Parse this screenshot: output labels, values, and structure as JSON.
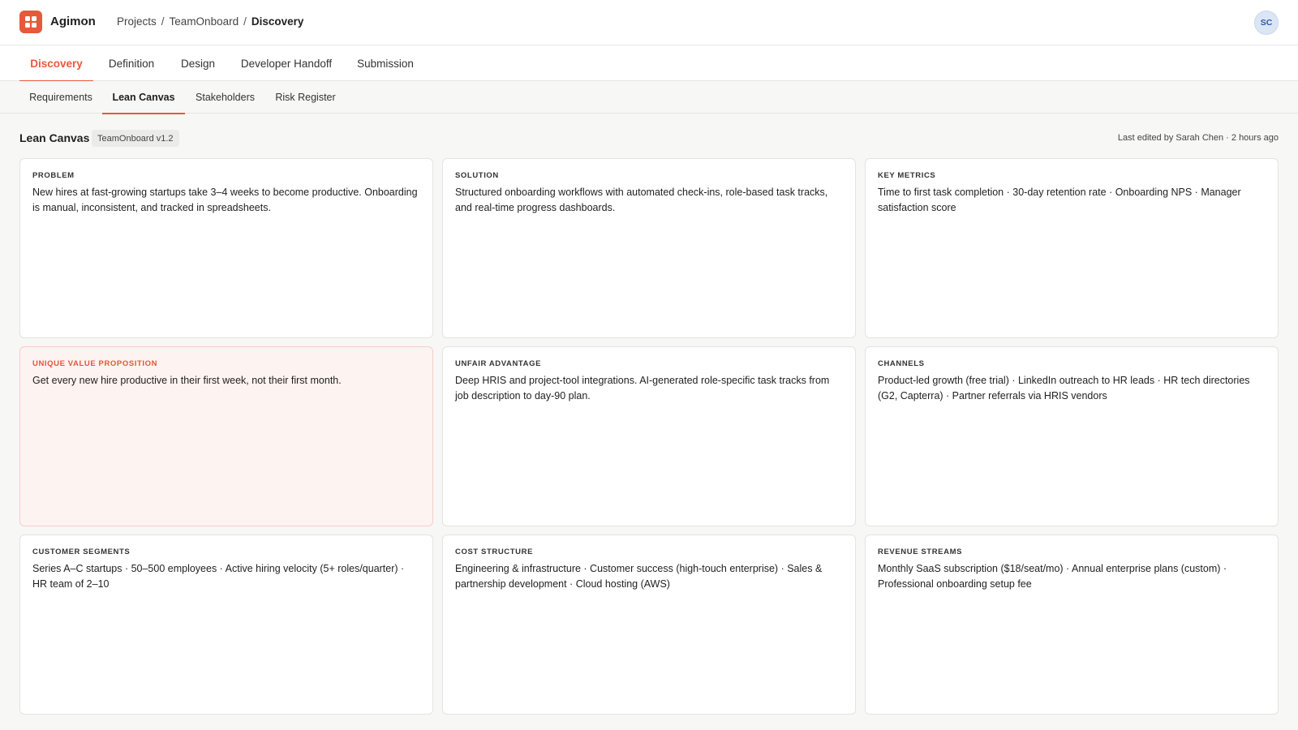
{
  "app": {
    "name": "Agimon"
  },
  "breadcrumb": {
    "items": [
      "Projects",
      "TeamOnboard",
      "Discovery"
    ]
  },
  "user": {
    "initials": "SC"
  },
  "main_tabs": [
    "Discovery",
    "Definition",
    "Design",
    "Developer Handoff",
    "Submission"
  ],
  "main_tab_active": "Discovery",
  "sub_tabs": [
    "Requirements",
    "Lean Canvas",
    "Stakeholders",
    "Risk Register"
  ],
  "sub_tab_active": "Lean Canvas",
  "page": {
    "title": "Lean Canvas",
    "badge": "TeamOnboard v1.2",
    "last_edited": "Last edited by Sarah Chen · 2 hours ago"
  },
  "canvas": {
    "cells": [
      {
        "label": "Problem",
        "text": "New hires at fast-growing startups take 3–4 weeks to become productive. Onboarding is manual, inconsistent, and tracked in spreadsheets."
      },
      {
        "label": "Solution",
        "text": "Structured onboarding workflows with automated check-ins, role-based task tracks, and real-time progress dashboards."
      },
      {
        "label": "Key Metrics",
        "text": "Time to first task completion · 30-day retention rate · Onboarding NPS · Manager satisfaction score"
      },
      {
        "label": "Unique Value Proposition",
        "text": "Get every new hire productive in their first week, not their first month."
      },
      {
        "label": "Unfair Advantage",
        "text": "Deep HRIS and project-tool integrations. AI-generated role-specific task tracks from job description to day-90 plan."
      },
      {
        "label": "Channels",
        "text": "Product-led growth (free trial) · LinkedIn outreach to HR leads · HR tech directories (G2, Capterra) · Partner referrals via HRIS vendors"
      },
      {
        "label": "Customer Segments",
        "text": "Series A–C startups · 50–500 employees · Active hiring velocity (5+ roles/quarter) · HR team of 2–10"
      },
      {
        "label": "Cost Structure",
        "text": "Engineering & infrastructure · Customer success (high-touch enterprise) · Sales & partnership development · Cloud hosting (AWS)"
      },
      {
        "label": "Revenue Streams",
        "text": "Monthly SaaS subscription ($18/seat/mo) · Annual enterprise plans (custom) · Professional onboarding setup fee"
      }
    ]
  },
  "colors": {
    "accent": "#e8583a",
    "highlight_bg": "#fdf3f1",
    "avatar_bg": "#dbe6f5"
  }
}
